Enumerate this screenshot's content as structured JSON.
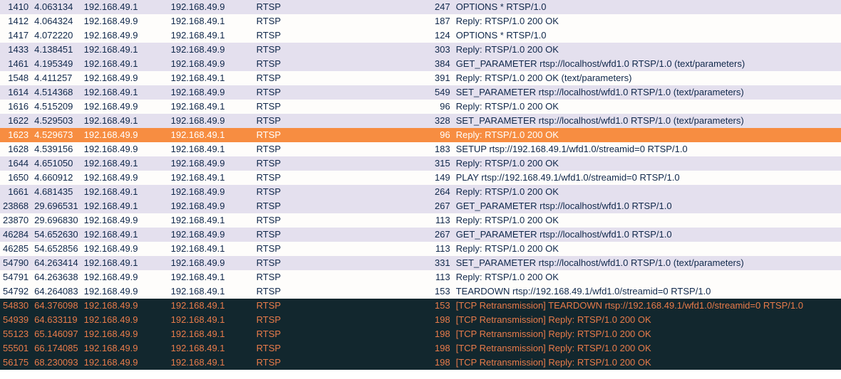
{
  "packets": [
    {
      "no": "1410",
      "time": "4.063134",
      "src": "192.168.49.1",
      "dst": "192.168.49.9",
      "proto": "RTSP",
      "len": "247",
      "info": "OPTIONS * RTSP/1.0",
      "rowcls": "row-light-purple"
    },
    {
      "no": "1412",
      "time": "4.064324",
      "src": "192.168.49.9",
      "dst": "192.168.49.1",
      "proto": "RTSP",
      "len": "187",
      "info": "Reply: RTSP/1.0 200 OK",
      "rowcls": "row-white"
    },
    {
      "no": "1417",
      "time": "4.072220",
      "src": "192.168.49.9",
      "dst": "192.168.49.1",
      "proto": "RTSP",
      "len": "124",
      "info": "OPTIONS * RTSP/1.0",
      "rowcls": "row-white"
    },
    {
      "no": "1433",
      "time": "4.138451",
      "src": "192.168.49.1",
      "dst": "192.168.49.9",
      "proto": "RTSP",
      "len": "303",
      "info": "Reply: RTSP/1.0 200 OK",
      "rowcls": "row-light-purple"
    },
    {
      "no": "1461",
      "time": "4.195349",
      "src": "192.168.49.1",
      "dst": "192.168.49.9",
      "proto": "RTSP",
      "len": "384",
      "info": "GET_PARAMETER rtsp://localhost/wfd1.0 RTSP/1.0 (text/parameters)",
      "rowcls": "row-light-purple"
    },
    {
      "no": "1548",
      "time": "4.411257",
      "src": "192.168.49.9",
      "dst": "192.168.49.1",
      "proto": "RTSP",
      "len": "391",
      "info": "Reply: RTSP/1.0 200 OK (text/parameters)",
      "rowcls": "row-white"
    },
    {
      "no": "1614",
      "time": "4.514368",
      "src": "192.168.49.1",
      "dst": "192.168.49.9",
      "proto": "RTSP",
      "len": "549",
      "info": "SET_PARAMETER rtsp://localhost/wfd1.0 RTSP/1.0 (text/parameters)",
      "rowcls": "row-light-purple"
    },
    {
      "no": "1616",
      "time": "4.515209",
      "src": "192.168.49.9",
      "dst": "192.168.49.1",
      "proto": "RTSP",
      "len": "96",
      "info": "Reply: RTSP/1.0 200 OK",
      "rowcls": "row-white"
    },
    {
      "no": "1622",
      "time": "4.529503",
      "src": "192.168.49.1",
      "dst": "192.168.49.9",
      "proto": "RTSP",
      "len": "328",
      "info": "SET_PARAMETER rtsp://localhost/wfd1.0 RTSP/1.0 (text/parameters)",
      "rowcls": "row-light-purple"
    },
    {
      "no": "1623",
      "time": "4.529673",
      "src": "192.168.49.9",
      "dst": "192.168.49.1",
      "proto": "RTSP",
      "len": "96",
      "info": "Reply: RTSP/1.0 200 OK",
      "rowcls": "row-selected"
    },
    {
      "no": "1628",
      "time": "4.539156",
      "src": "192.168.49.9",
      "dst": "192.168.49.1",
      "proto": "RTSP",
      "len": "183",
      "info": "SETUP rtsp://192.168.49.1/wfd1.0/streamid=0 RTSP/1.0",
      "rowcls": "row-white"
    },
    {
      "no": "1644",
      "time": "4.651050",
      "src": "192.168.49.1",
      "dst": "192.168.49.9",
      "proto": "RTSP",
      "len": "315",
      "info": "Reply: RTSP/1.0 200 OK",
      "rowcls": "row-light-purple"
    },
    {
      "no": "1650",
      "time": "4.660912",
      "src": "192.168.49.9",
      "dst": "192.168.49.1",
      "proto": "RTSP",
      "len": "149",
      "info": "PLAY rtsp://192.168.49.1/wfd1.0/streamid=0 RTSP/1.0",
      "rowcls": "row-white"
    },
    {
      "no": "1661",
      "time": "4.681435",
      "src": "192.168.49.1",
      "dst": "192.168.49.9",
      "proto": "RTSP",
      "len": "264",
      "info": "Reply: RTSP/1.0 200 OK",
      "rowcls": "row-light-purple"
    },
    {
      "no": "23868",
      "time": "29.696531",
      "src": "192.168.49.1",
      "dst": "192.168.49.9",
      "proto": "RTSP",
      "len": "267",
      "info": "GET_PARAMETER rtsp://localhost/wfd1.0 RTSP/1.0",
      "rowcls": "row-light-purple"
    },
    {
      "no": "23870",
      "time": "29.696830",
      "src": "192.168.49.9",
      "dst": "192.168.49.1",
      "proto": "RTSP",
      "len": "113",
      "info": "Reply: RTSP/1.0 200 OK",
      "rowcls": "row-white"
    },
    {
      "no": "46284",
      "time": "54.652630",
      "src": "192.168.49.1",
      "dst": "192.168.49.9",
      "proto": "RTSP",
      "len": "267",
      "info": "GET_PARAMETER rtsp://localhost/wfd1.0 RTSP/1.0",
      "rowcls": "row-light-purple"
    },
    {
      "no": "46285",
      "time": "54.652856",
      "src": "192.168.49.9",
      "dst": "192.168.49.1",
      "proto": "RTSP",
      "len": "113",
      "info": "Reply: RTSP/1.0 200 OK",
      "rowcls": "row-white"
    },
    {
      "no": "54790",
      "time": "64.263414",
      "src": "192.168.49.1",
      "dst": "192.168.49.9",
      "proto": "RTSP",
      "len": "331",
      "info": "SET_PARAMETER rtsp://localhost/wfd1.0 RTSP/1.0 (text/parameters)",
      "rowcls": "row-light-purple"
    },
    {
      "no": "54791",
      "time": "64.263638",
      "src": "192.168.49.9",
      "dst": "192.168.49.1",
      "proto": "RTSP",
      "len": "113",
      "info": "Reply: RTSP/1.0 200 OK",
      "rowcls": "row-white"
    },
    {
      "no": "54792",
      "time": "64.264083",
      "src": "192.168.49.9",
      "dst": "192.168.49.1",
      "proto": "RTSP",
      "len": "153",
      "info": "TEARDOWN rtsp://192.168.49.1/wfd1.0/streamid=0 RTSP/1.0",
      "rowcls": "row-white"
    },
    {
      "no": "54830",
      "time": "64.376098",
      "src": "192.168.49.9",
      "dst": "192.168.49.1",
      "proto": "RTSP",
      "len": "153",
      "info": "[TCP Retransmission] TEARDOWN rtsp://192.168.49.1/wfd1.0/streamid=0 RTSP/1.0",
      "rowcls": "row-dark"
    },
    {
      "no": "54939",
      "time": "64.633119",
      "src": "192.168.49.9",
      "dst": "192.168.49.1",
      "proto": "RTSP",
      "len": "198",
      "info": "[TCP Retransmission] Reply: RTSP/1.0 200 OK",
      "rowcls": "row-dark"
    },
    {
      "no": "55123",
      "time": "65.146097",
      "src": "192.168.49.9",
      "dst": "192.168.49.1",
      "proto": "RTSP",
      "len": "198",
      "info": "[TCP Retransmission] Reply: RTSP/1.0 200 OK",
      "rowcls": "row-dark"
    },
    {
      "no": "55501",
      "time": "66.174085",
      "src": "192.168.49.9",
      "dst": "192.168.49.1",
      "proto": "RTSP",
      "len": "198",
      "info": "[TCP Retransmission] Reply: RTSP/1.0 200 OK",
      "rowcls": "row-dark"
    },
    {
      "no": "56175",
      "time": "68.230093",
      "src": "192.168.49.9",
      "dst": "192.168.49.1",
      "proto": "RTSP",
      "len": "198",
      "info": "[TCP Retransmission] Reply: RTSP/1.0 200 OK",
      "rowcls": "row-dark"
    }
  ]
}
